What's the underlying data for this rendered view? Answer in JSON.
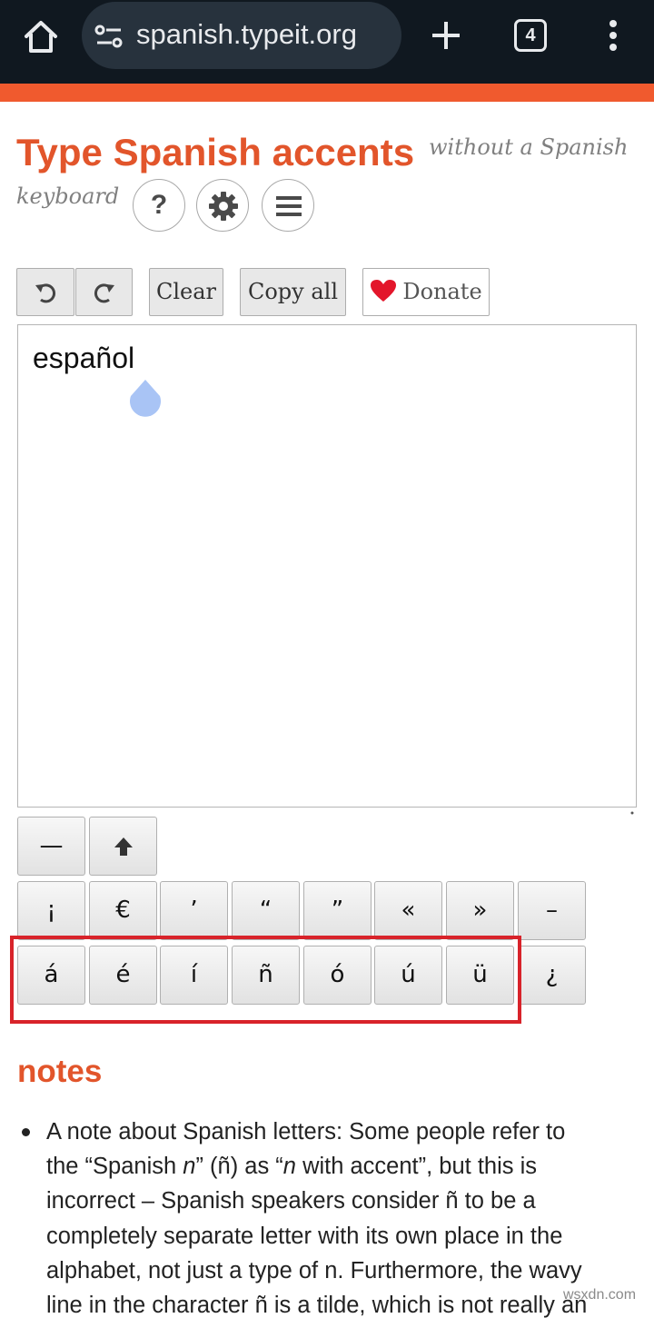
{
  "browser": {
    "url": "spanish.typeit.org",
    "tab_count": "4"
  },
  "header": {
    "title": "Type Spanish accents",
    "subtitle_part1": "without a Spanish",
    "subtitle_part2": "keyboard",
    "help_label": "?"
  },
  "toolbar": {
    "clear_label": "Clear",
    "copy_all_label": "Copy all",
    "donate_label": "Donate"
  },
  "editor": {
    "value": "español"
  },
  "keys": {
    "row0": [
      "—",
      "⬆"
    ],
    "row1": [
      "¡",
      "€",
      "’",
      "“",
      "”",
      "«",
      "»",
      "–"
    ],
    "row2": [
      "á",
      "é",
      "í",
      "ñ",
      "ó",
      "ú",
      "ü",
      "¿"
    ]
  },
  "notes": {
    "heading": "notes",
    "l1": "A note about Spanish letters: Some people refer to",
    "l2a": "the “Spanish ",
    "l2b": "n",
    "l2c": "” (ñ) as “",
    "l2d": "n",
    "l2e": " with accent”, but this is",
    "l3": "incorrect – Spanish speakers consider ñ to be a",
    "l4": "completely separate letter with its own place in the",
    "l5": "alphabet, not just a type of n. Furthermore, the wavy",
    "l6": "line in the character ñ is a tilde, which is not really an"
  },
  "watermark": "wsxdn.com",
  "colors": {
    "brand_orange": "#f05a2e",
    "title_orange": "#e2552b",
    "highlight_red": "#d8232a"
  }
}
